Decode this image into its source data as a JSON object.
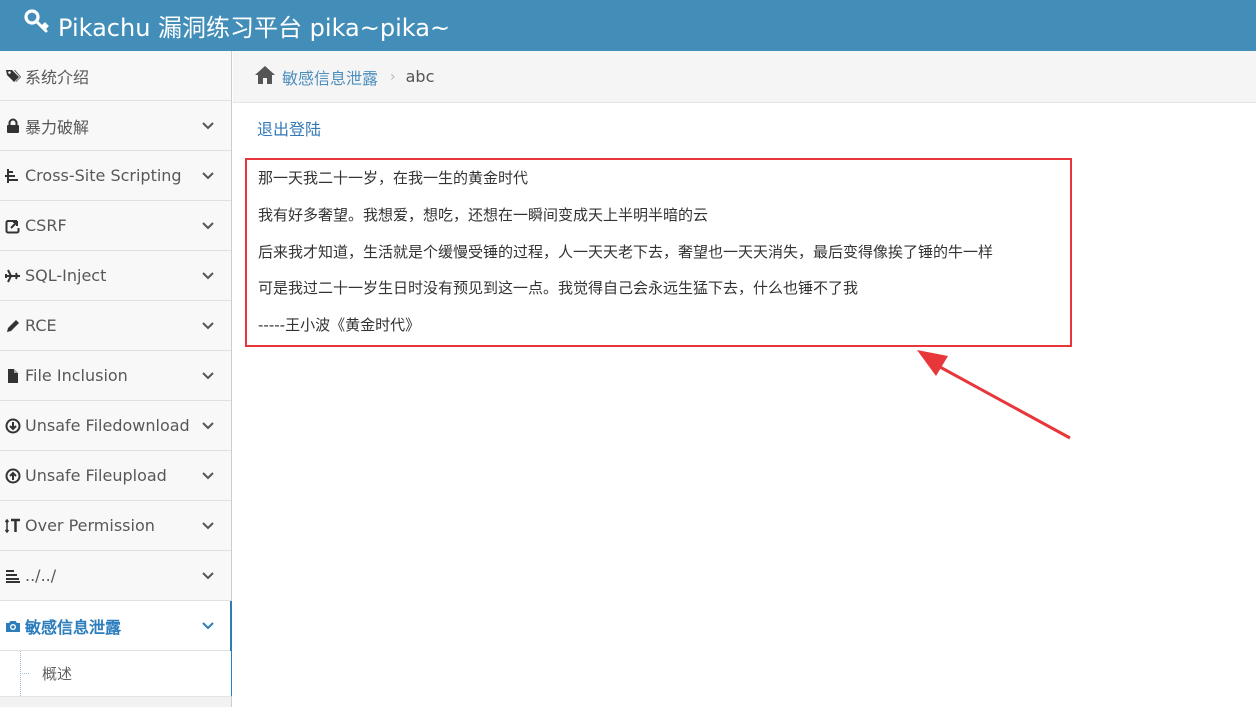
{
  "header": {
    "title": "Pikachu 漏洞练习平台 pika~pika~",
    "icon": "key-icon"
  },
  "sidebar": {
    "items": [
      {
        "label": "系统介绍",
        "icon": "tags-icon",
        "has_chevron": false
      },
      {
        "label": "暴力破解",
        "icon": "lock-icon",
        "has_chevron": true
      },
      {
        "label": "Cross-Site Scripting",
        "icon": "sitemap-icon",
        "has_chevron": true
      },
      {
        "label": "CSRF",
        "icon": "share-icon",
        "has_chevron": true
      },
      {
        "label": "SQL-Inject",
        "icon": "plane-icon",
        "has_chevron": true
      },
      {
        "label": "RCE",
        "icon": "pencil-icon",
        "has_chevron": true
      },
      {
        "label": "File Inclusion",
        "icon": "file-icon",
        "has_chevron": true
      },
      {
        "label": "Unsafe Filedownload",
        "icon": "download-circle-icon",
        "has_chevron": true
      },
      {
        "label": "Unsafe Fileupload",
        "icon": "upload-circle-icon",
        "has_chevron": true
      },
      {
        "label": "Over Permission",
        "icon": "text-height-icon",
        "has_chevron": true
      },
      {
        "label": "../../",
        "icon": "align-left-icon",
        "has_chevron": true
      },
      {
        "label": "敏感信息泄露",
        "icon": "camera-icon",
        "has_chevron": true,
        "active": true
      }
    ],
    "sub_items": [
      {
        "label": "概述"
      }
    ]
  },
  "breadcrumbs": {
    "icon": "home-icon",
    "parent": "敏感信息泄露",
    "current": "abc"
  },
  "main": {
    "logout_label": "退出登陆",
    "poem": [
      "那一天我二十一岁，在我一生的黄金时代",
      "我有好多奢望。我想爱，想吃，还想在一瞬间变成天上半明半暗的云",
      "后来我才知道，生活就是个缓慢受锤的过程，人一天天老下去，奢望也一天天消失，最后变得像挨了锤的牛一样",
      "可是我过二十一岁生日时没有预见到这一点。我觉得自己会永远生猛下去，什么也锤不了我",
      "-----王小波《黄金时代》"
    ]
  },
  "colors": {
    "header_bg": "#438eb9",
    "link": "#4c8fbd",
    "active_nav": "#2b7dbc",
    "highlight_box": "#e8373b"
  }
}
